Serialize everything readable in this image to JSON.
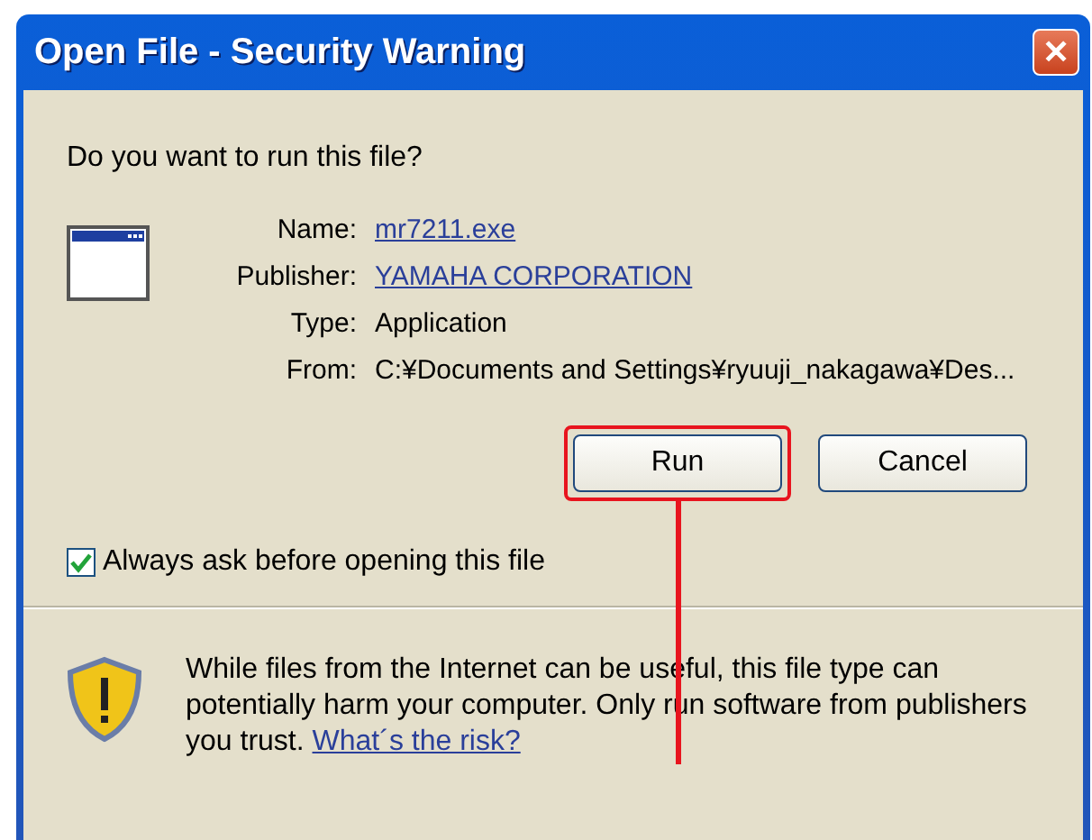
{
  "window": {
    "title": "Open File - Security Warning",
    "close": "✕"
  },
  "question": "Do you want to run this file?",
  "details": [
    {
      "label": "Name:",
      "value": "mr7211.exe",
      "kind": "link"
    },
    {
      "label": "Publisher:",
      "value": "YAMAHA CORPORATION",
      "kind": "link"
    },
    {
      "label": "Type:",
      "value": "Application",
      "kind": "text"
    },
    {
      "label": "From:",
      "value": "C:¥Documents and Settings¥ryuuji_nakagawa¥Des...",
      "kind": "text"
    }
  ],
  "buttons": [
    {
      "label": "Run",
      "highlighted": true
    },
    {
      "label": "Cancel",
      "highlighted": false
    }
  ],
  "always_ask": {
    "label": "Always ask before opening this file",
    "checked": true
  },
  "warning": {
    "text": "While files from the Internet can be useful, this file type can potentially harm your computer. Only run software from publishers you trust.",
    "link": "What´s the risk?"
  }
}
